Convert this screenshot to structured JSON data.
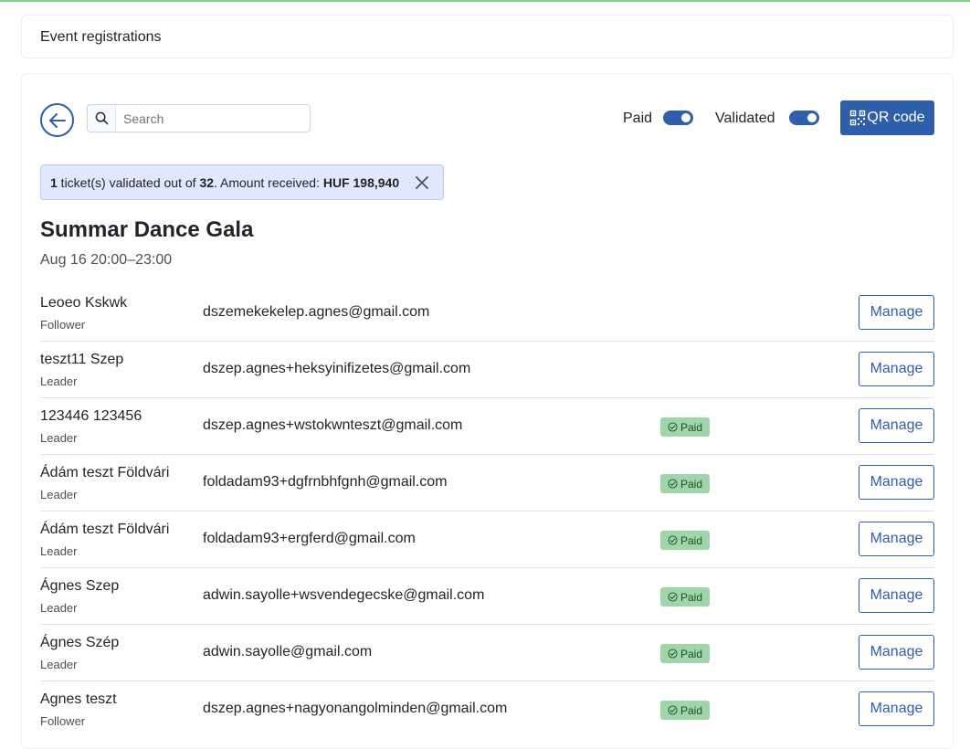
{
  "header": {
    "title": "Event registrations"
  },
  "toolbar": {
    "search_placeholder": "Search",
    "paid_label": "Paid",
    "validated_label": "Validated",
    "qr_label": "QR code"
  },
  "summary": {
    "validated_count": "1",
    "text1": " ticket(s) validated out of ",
    "total": "32",
    "text2": ". Amount received: ",
    "amount": "HUF 198,940"
  },
  "event": {
    "title": "Summar Dance Gala",
    "date": "Aug 16 20:00–23:00"
  },
  "manage_label": "Manage",
  "paid_badge_label": "Paid",
  "registrations": [
    {
      "name": "Leoeo Kskwk",
      "role": "Follower",
      "email": "dszemekekelep.agnes@gmail.com",
      "paid": false
    },
    {
      "name": "teszt11 Szep",
      "role": "Leader",
      "email": "dszep.agnes+heksyinifizetes@gmail.com",
      "paid": false
    },
    {
      "name": "123446 123456",
      "role": "Leader",
      "email": "dszep.agnes+wstokwnteszt@gmail.com",
      "paid": true
    },
    {
      "name": "Ádám teszt Földvári",
      "role": "Leader",
      "email": "foldadam93+dgfrnbhfgnh@gmail.com",
      "paid": true
    },
    {
      "name": "Ádám teszt Földvári",
      "role": "Leader",
      "email": "foldadam93+ergferd@gmail.com",
      "paid": true
    },
    {
      "name": "Ágnes Szep",
      "role": "Leader",
      "email": "adwin.sayolle+wsvendegecske@gmail.com",
      "paid": true
    },
    {
      "name": "Ágnes Szép",
      "role": "Leader",
      "email": "adwin.sayolle@gmail.com",
      "paid": true
    },
    {
      "name": "Agnes teszt",
      "role": "Follower",
      "email": "dszep.agnes+nagyonangolminden@gmail.com",
      "paid": true
    }
  ],
  "colors": {
    "primary": "#2f5faa",
    "paid_badge": "#9fd5a8",
    "alert_bg": "#dfe9fb",
    "top_accent": "#7fd18a"
  }
}
